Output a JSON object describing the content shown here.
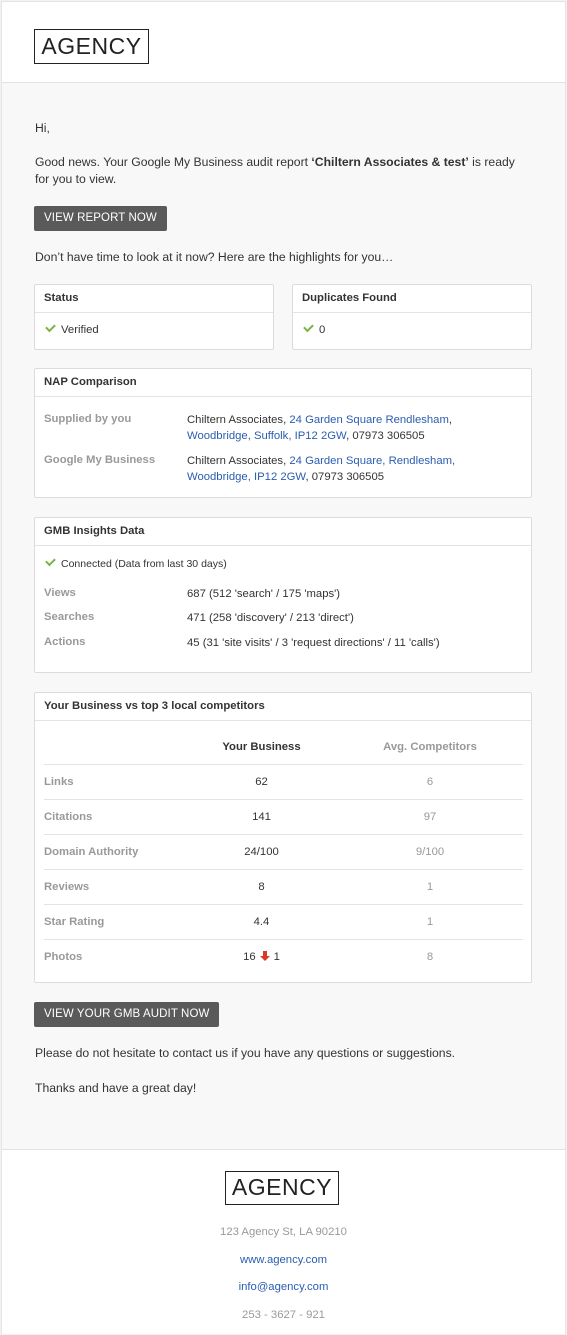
{
  "brand": {
    "logo_text": "AGENCY"
  },
  "greeting": "Hi,",
  "intro": {
    "prefix": "Good news. Your Google My Business audit report ",
    "report_name": "‘Chiltern Associates & test’",
    "suffix_line1": " is ready",
    "line2": "for you to view."
  },
  "buttons": {
    "view_report": "VIEW REPORT NOW",
    "view_audit": "VIEW YOUR GMB AUDIT NOW"
  },
  "highlights_text": "Don’t have time to look at it now? Here are the highlights for you…",
  "status_card": {
    "title": "Status",
    "value": "Verified"
  },
  "duplicates_card": {
    "title": "Duplicates Found",
    "value": "0"
  },
  "nap": {
    "title": "NAP Comparison",
    "rows": [
      {
        "label": "Supplied by you",
        "name": "Chiltern Associates, ",
        "addr1": "24 Garden Square Rendlesham",
        "sep1": ",",
        "addr2": "Woodbridge, Suffolk, IP12 2GW",
        "phone": ", 07973 306505"
      },
      {
        "label": "Google My Business",
        "name": "Chiltern Associates, ",
        "addr1": "24 Garden Square, Rendlesham,",
        "sep1": "",
        "addr2": "Woodbridge, IP12 2GW",
        "phone": ", 07973 306505"
      }
    ]
  },
  "insights": {
    "title": "GMB Insights Data",
    "connected": "Connected (Data from last 30 days)",
    "rows": [
      {
        "label": "Views",
        "value": "687 (512 'search' / 175 'maps')"
      },
      {
        "label": "Searches",
        "value": "471 (258 'discovery' / 213 'direct')"
      },
      {
        "label": "Actions",
        "value": "45 (31 'site visits' / 3 'request directions' / 11 'calls')"
      }
    ]
  },
  "competitors": {
    "title": "Your Business vs top 3 local competitors",
    "col_you": "Your Business",
    "col_avg": "Avg. Competitors",
    "rows": [
      {
        "label": "Links",
        "you": "62",
        "avg": "6"
      },
      {
        "label": "Citations",
        "you": "141",
        "avg": "97"
      },
      {
        "label": "Domain Authority",
        "you": "24/100",
        "avg": "9/100"
      },
      {
        "label": "Reviews",
        "you": "8",
        "avg": "1"
      },
      {
        "label": "Star Rating",
        "you": "4.4",
        "avg": "1"
      },
      {
        "label": "Photos",
        "you": "16",
        "you_change": "1",
        "avg": "8"
      }
    ]
  },
  "closing": {
    "contact": "Please do not hesitate to contact us if you have any questions or suggestions.",
    "thanks": "Thanks and have a great day!"
  },
  "footer": {
    "address": "123 Agency St, LA 90210",
    "website": "www.agency.com",
    "email": "info@agency.com",
    "phone": "253 - 3627 - 921"
  },
  "colors": {
    "button": "#5a5a5a",
    "link": "#2a5db0",
    "check": "#7cb342",
    "down_arrow": "#d9382b"
  }
}
